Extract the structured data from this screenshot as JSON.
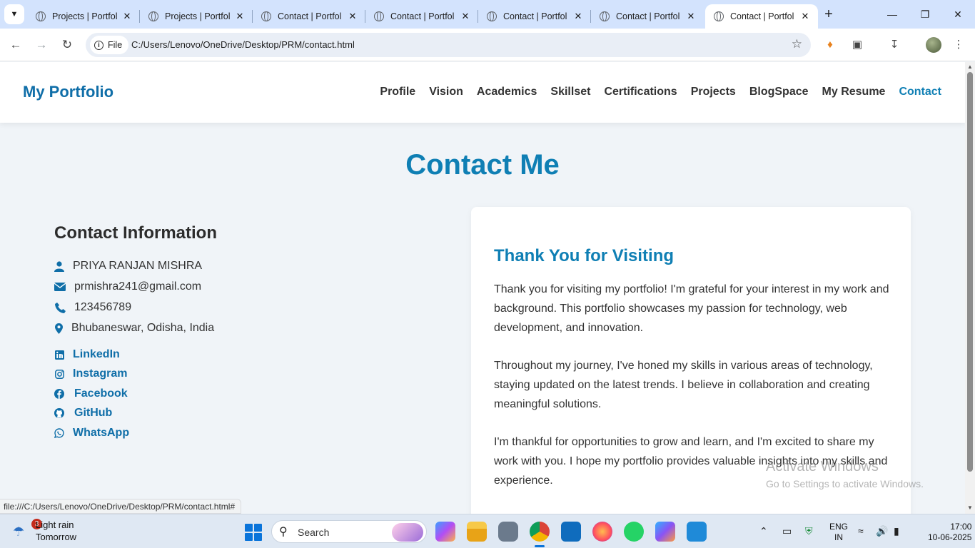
{
  "browser": {
    "tabs": [
      {
        "title": "Projects | Portfol",
        "active": false
      },
      {
        "title": "Projects | Portfol",
        "active": false
      },
      {
        "title": "Contact | Portfol",
        "active": false
      },
      {
        "title": "Contact | Portfol",
        "active": false
      },
      {
        "title": "Contact | Portfol",
        "active": false
      },
      {
        "title": "Contact | Portfol",
        "active": false
      },
      {
        "title": "Contact | Portfol",
        "active": true
      }
    ],
    "scheme_label": "File",
    "url": "C:/Users/Lenovo/OneDrive/Desktop/PRM/contact.html",
    "status_url": "file:///C:/Users/Lenovo/OneDrive/Desktop/PRM/contact.html#"
  },
  "site": {
    "brand": "My Portfolio",
    "nav": [
      "Profile",
      "Vision",
      "Academics",
      "Skillset",
      "Certifications",
      "Projects",
      "BlogSpace",
      "My Resume",
      "Contact"
    ],
    "active_nav": "Contact",
    "page_title": "Contact Me"
  },
  "contact": {
    "heading": "Contact Information",
    "name": "PRIYA RANJAN MISHRA",
    "email": "prmishra241@gmail.com",
    "phone": "123456789",
    "location": "Bhubaneswar, Odisha, India",
    "social": [
      "LinkedIn",
      "Instagram",
      "Facebook",
      "GitHub",
      "WhatsApp"
    ]
  },
  "card": {
    "heading": "Thank You for Visiting",
    "p1": "Thank you for visiting my portfolio! I'm grateful for your interest in my work and background. This portfolio showcases my passion for technology, web development, and innovation.",
    "p2": "Throughout my journey, I've honed my skills in various areas of technology, staying updated on the latest trends. I believe in collaboration and creating meaningful solutions.",
    "p3": "I'm thankful for opportunities to grow and learn, and I'm excited to share my work with you. I hope my portfolio provides valuable insights into my skills and experience."
  },
  "watermark": {
    "line1": "Activate Windows",
    "line2": "Go to Settings to activate Windows."
  },
  "taskbar": {
    "weather_badge": "3",
    "weather_line1": "Light rain",
    "weather_line2": "Tomorrow",
    "search_label": "Search",
    "lang_line1": "ENG",
    "lang_line2": "IN",
    "time": "17:00",
    "date": "10-06-2025"
  },
  "colors": {
    "accent": "#0f7fb4",
    "brand": "#0f6ea8",
    "tabstrip": "#d3e3fd",
    "page_bg": "#f0f4f8"
  }
}
